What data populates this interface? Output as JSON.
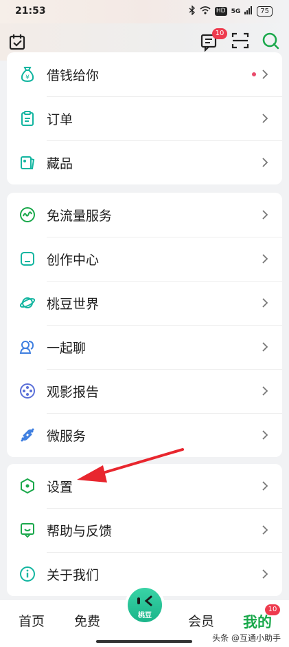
{
  "status_bar": {
    "time": "21:53",
    "signal": "5G",
    "hd": "HD",
    "battery": "75"
  },
  "header": {
    "message_badge": "10"
  },
  "cards": [
    {
      "items": [
        {
          "label": "借钱给你",
          "icon": "money-bag-icon",
          "has_dot": true
        },
        {
          "label": "订单",
          "icon": "clipboard-icon"
        },
        {
          "label": "藏品",
          "icon": "collection-icon"
        }
      ]
    },
    {
      "items": [
        {
          "label": "免流量服务",
          "icon": "wave-circle-icon"
        },
        {
          "label": "创作中心",
          "icon": "creation-icon"
        },
        {
          "label": "桃豆世界",
          "icon": "planet-icon"
        },
        {
          "label": "一起聊",
          "icon": "chat-people-icon"
        },
        {
          "label": "观影报告",
          "icon": "film-reel-icon"
        },
        {
          "label": "微服务",
          "icon": "link-icon"
        }
      ]
    },
    {
      "items": [
        {
          "label": "设置",
          "icon": "hexagon-settings-icon"
        },
        {
          "label": "帮助与反馈",
          "icon": "feedback-icon"
        },
        {
          "label": "关于我们",
          "icon": "info-icon"
        }
      ]
    }
  ],
  "bottom_nav": {
    "home": "首页",
    "free": "免费",
    "center": "桃豆",
    "member": "会员",
    "mine": "我的",
    "mine_badge": "10"
  },
  "watermark": "头条 @互通小助手",
  "colors": {
    "accent_green": "#1aa84b",
    "icon_teal": "#12b5a0",
    "badge_red": "#ee3b4e",
    "annotation_red": "#e8262e"
  }
}
